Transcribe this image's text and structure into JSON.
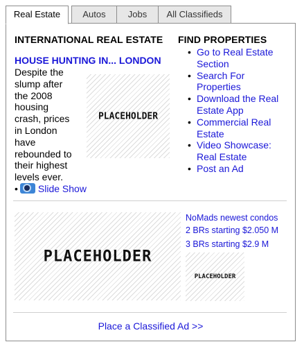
{
  "tabs": [
    {
      "label": "Real Estate",
      "active": true
    },
    {
      "label": "Autos",
      "active": false
    },
    {
      "label": "Jobs",
      "active": false
    },
    {
      "label": "All Classifieds",
      "active": false
    }
  ],
  "international": {
    "title": "INTERNATIONAL REAL ESTATE",
    "headline": "HOUSE HUNTING IN... LONDON",
    "story_lines": [
      "Despite the",
      "slump after",
      "the 2008",
      "housing",
      "crash, prices",
      "in London",
      "have",
      "rebounded to",
      "their highest",
      "levels ever."
    ],
    "image_text": "PLACEHOLDER",
    "slide_show_label": "Slide Show"
  },
  "find_properties": {
    "title": "FIND PROPERTIES",
    "links": [
      "Go to Real Estate Section",
      "Search For Properties",
      "Download the Real Estate App",
      "Commercial Real Estate",
      "Video Showcase: Real Estate",
      "Post an Ad"
    ]
  },
  "nomads": {
    "image_large_text": "PLACEHOLDER",
    "image_small_text": "PLACEHOLDER",
    "links": [
      "NoMads newest condos",
      "2 BRs starting $2.050 M",
      "3 BRs starting $2.9 M"
    ]
  },
  "footer": {
    "place_ad_label": "Place a Classified Ad >>"
  },
  "colors": {
    "link": "#1a17d8",
    "tab_border": "#8d8d8d",
    "tab_inactive_bg": "#e7e7e7"
  },
  "icons": [
    "camera-icon"
  ]
}
